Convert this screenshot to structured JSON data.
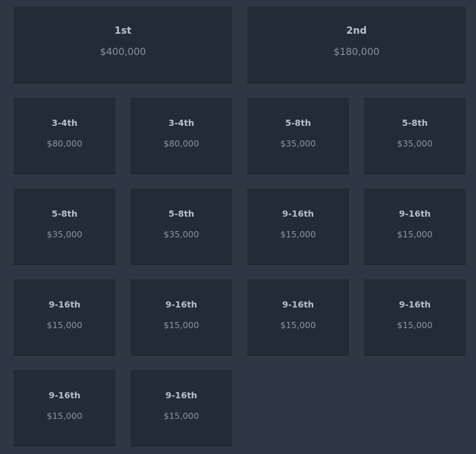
{
  "prizes": [
    {
      "place": "1st",
      "amount": "$400,000"
    },
    {
      "place": "2nd",
      "amount": "$180,000"
    },
    {
      "place": "3-4th",
      "amount": "$80,000"
    },
    {
      "place": "3-4th",
      "amount": "$80,000"
    },
    {
      "place": "5-8th",
      "amount": "$35,000"
    },
    {
      "place": "5-8th",
      "amount": "$35,000"
    },
    {
      "place": "5-8th",
      "amount": "$35,000"
    },
    {
      "place": "5-8th",
      "amount": "$35,000"
    },
    {
      "place": "9-16th",
      "amount": "$15,000"
    },
    {
      "place": "9-16th",
      "amount": "$15,000"
    },
    {
      "place": "9-16th",
      "amount": "$15,000"
    },
    {
      "place": "9-16th",
      "amount": "$15,000"
    },
    {
      "place": "9-16th",
      "amount": "$15,000"
    },
    {
      "place": "9-16th",
      "amount": "$15,000"
    },
    {
      "place": "9-16th",
      "amount": "$15,000"
    },
    {
      "place": "9-16th",
      "amount": "$15,000"
    }
  ]
}
